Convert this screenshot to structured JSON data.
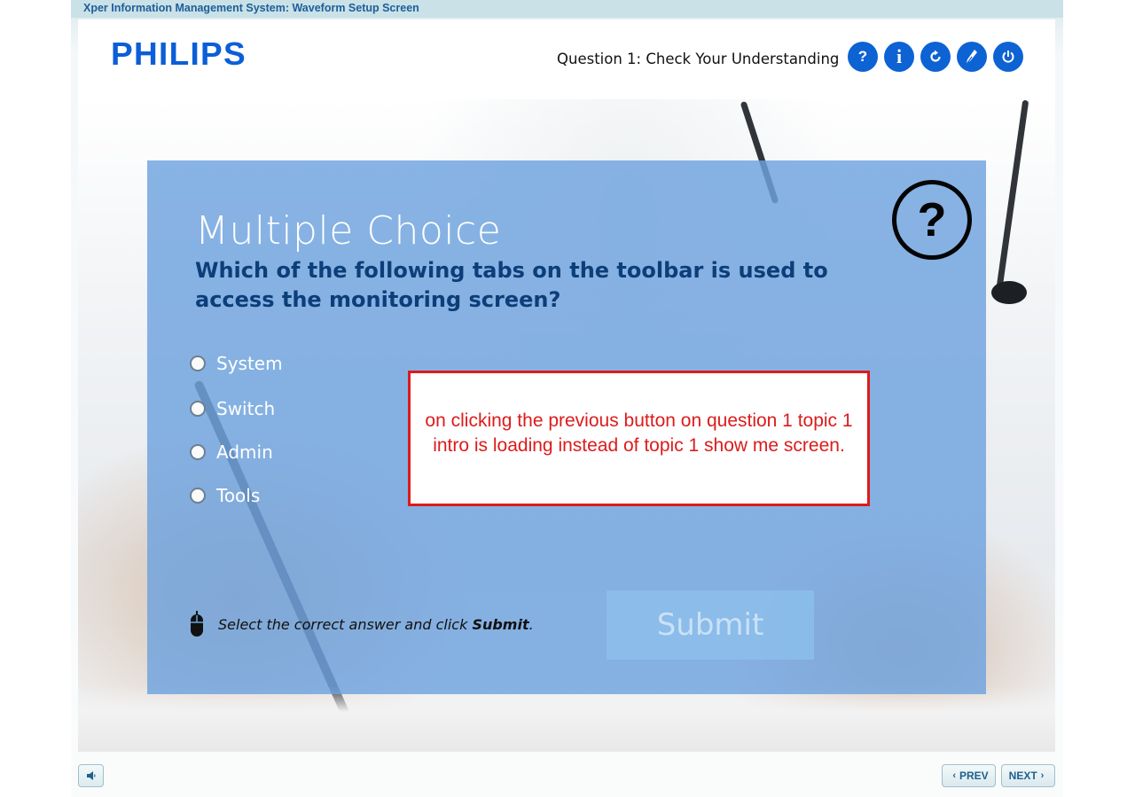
{
  "window": {
    "title": "Xper Information Management System: Waveform Setup Screen"
  },
  "header": {
    "logo": "PHILIPS",
    "question_label": "Question 1: Check Your Understanding",
    "buttons": [
      {
        "name": "help",
        "icon": "question-icon",
        "glyph": "?"
      },
      {
        "name": "info",
        "icon": "info-icon",
        "glyph": "i"
      },
      {
        "name": "replay",
        "icon": "replay-icon"
      },
      {
        "name": "resources",
        "icon": "pen-icon"
      },
      {
        "name": "exit",
        "icon": "power-icon"
      }
    ]
  },
  "quiz": {
    "type_title": "Multiple Choice",
    "question": "Which of the following tabs on the toolbar is used to access the monitoring screen?",
    "choices": [
      "System",
      "Switch",
      "Admin",
      "Tools"
    ],
    "instruction_prefix": "Select the correct answer and click ",
    "instruction_bold": "Submit",
    "instruction_suffix": ".",
    "submit_label": "Submit",
    "help_glyph": "?"
  },
  "annotation": {
    "text": "on clicking the previous button on question 1 topic 1 intro is loading instead of topic 1 show me screen.",
    "color": "#dd1b1b"
  },
  "footer": {
    "prev_label": "PREV",
    "next_label": "NEXT"
  },
  "colors": {
    "brand_blue": "#0b5ed7",
    "panel": "#6ea2de",
    "question_text": "#0c3e79"
  }
}
